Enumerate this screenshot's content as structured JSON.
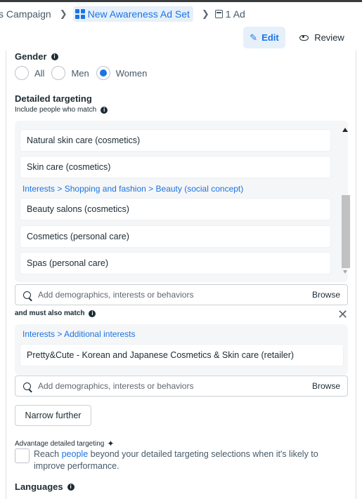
{
  "breadcrumb": {
    "campaign": "s Campaign",
    "adset": "New Awareness Ad Set",
    "ad": "1 Ad"
  },
  "toolbar": {
    "edit_label": "Edit",
    "review_label": "Review"
  },
  "gender": {
    "title": "Gender",
    "options": [
      "All",
      "Men",
      "Women"
    ],
    "selected": "Women"
  },
  "detailed_targeting": {
    "title": "Detailed targeting",
    "include_label": "Include people who match",
    "items_top": [
      "Natural skin care (cosmetics)",
      "Skin care (cosmetics)"
    ],
    "path": [
      "Interests",
      "Shopping and fashion",
      "Beauty (social concept)"
    ],
    "items_bottom": [
      "Beauty salons (cosmetics)",
      "Cosmetics (personal care)",
      "Spas (personal care)"
    ],
    "search_placeholder": "Add demographics, interests or behaviors",
    "browse_label": "Browse"
  },
  "must_also_match": {
    "label": "and must also match",
    "path": [
      "Interests",
      "Additional interests"
    ],
    "items": [
      "Pretty&Cute - Korean and Japanese Cosmetics & Skin care (retailer)"
    ],
    "search_placeholder": "Add demographics, interests or behaviors",
    "browse_label": "Browse"
  },
  "narrow_button": "Narrow further",
  "advantage": {
    "title": "Advantage detailed targeting",
    "text_before": "Reach ",
    "link": "people",
    "text_after": " beyond your detailed targeting selections when it's likely to improve performance."
  },
  "languages": {
    "title": "Languages"
  },
  "colors": {
    "accent": "#1b74e4",
    "accent_bg": "#e6f0fa",
    "text": "#1c2b33"
  }
}
